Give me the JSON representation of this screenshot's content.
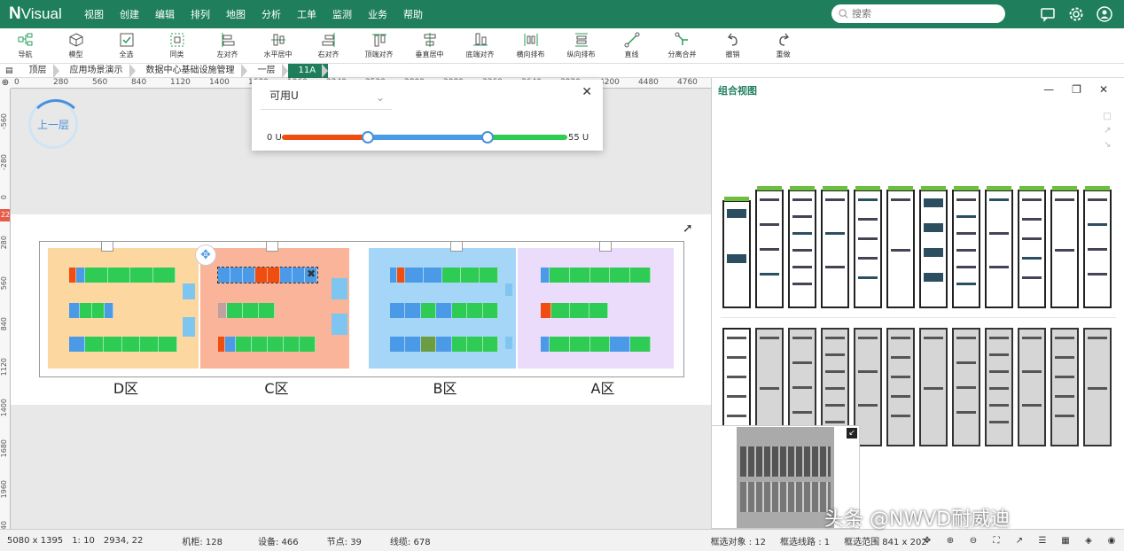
{
  "app": {
    "logo_n": "N",
    "logo_rest": "Visual"
  },
  "menu": [
    "视图",
    "创建",
    "编辑",
    "排列",
    "地图",
    "分析",
    "工单",
    "监测",
    "业务",
    "帮助"
  ],
  "search": {
    "placeholder": "搜索"
  },
  "toolbar": [
    "导航",
    "模型",
    "全选",
    "同类",
    "左对齐",
    "水平居中",
    "右对齐",
    "顶端对齐",
    "垂直居中",
    "底端对齐",
    "横向排布",
    "纵向排布",
    "直线",
    "分离合并",
    "撤销",
    "重做"
  ],
  "breadcrumb": [
    "顶层",
    "应用场景演示",
    "数据中心基础设施管理",
    "一层",
    "11A"
  ],
  "ruler_h": [
    "0",
    "280",
    "560",
    "840",
    "1120",
    "1400",
    "1680",
    "1960",
    "2240",
    "2520",
    "2800",
    "3080",
    "3360",
    "3640",
    "3920",
    "4200",
    "4480",
    "4760",
    "5040"
  ],
  "ruler_v": [
    "-560",
    "-280",
    "0",
    "280",
    "560",
    "840",
    "1120",
    "1400",
    "1680",
    "1960",
    "2240"
  ],
  "ruler_v_marker": "22",
  "canvas": {
    "up_level": "上一层",
    "zones": [
      "D区",
      "C区",
      "B区",
      "A区"
    ]
  },
  "filter": {
    "select_value": "可用U",
    "min_label": "0 U",
    "max_label": "55 U",
    "low_fraction": 0.3,
    "high_fraction": 0.72
  },
  "colors": {
    "brand": "#1f7f5c",
    "red": "#f04e10",
    "blue": "#4a9ae8",
    "green": "#2ecc55",
    "zoneD": "#fdd7a0",
    "zoneC": "#f9b49a",
    "zoneB": "#a5d6f8",
    "zoneA": "#eadcfa"
  },
  "right_panel": {
    "title": "组合视图"
  },
  "status": {
    "size": "5080 x 1395",
    "scale": "1: 10",
    "coords": "2934, 22",
    "racks": "机柜: 128",
    "devices": "设备: 466",
    "nodes": "节点: 39",
    "lines": "线缆: 678",
    "selected_objects": "框选对象 : 12",
    "selected_lines": "框选线路 : 1",
    "selected_range": "框选范围 841 x 202"
  },
  "watermark": "头条 @NWVD耐威迪"
}
